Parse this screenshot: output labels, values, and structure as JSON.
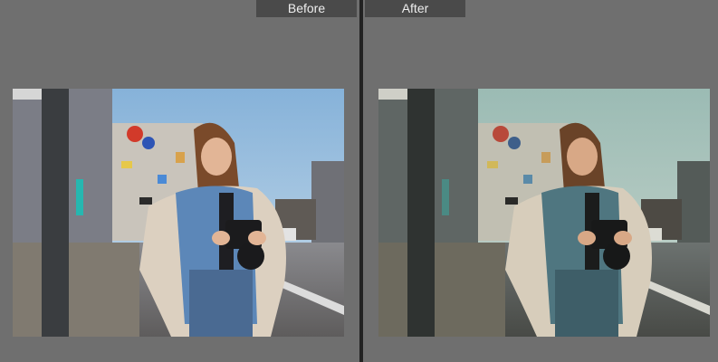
{
  "compare": {
    "before_label": "Before",
    "after_label": "After"
  },
  "colors": {
    "background": "#6f6f6f",
    "divider": "#222222",
    "label_bg": "#4a4a4a",
    "label_text": "#eeeeee"
  }
}
